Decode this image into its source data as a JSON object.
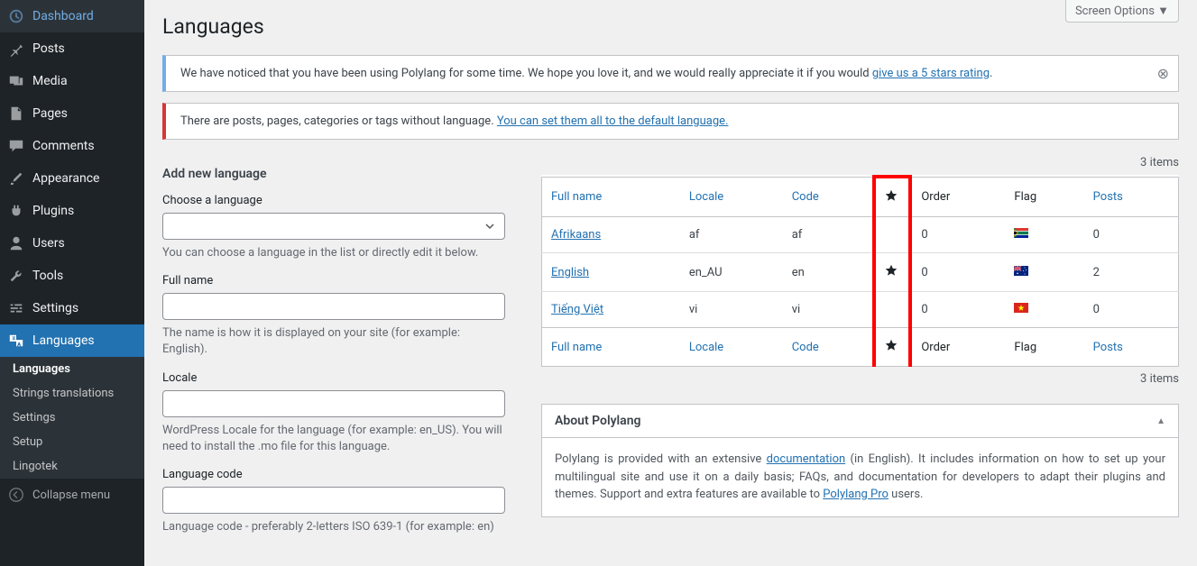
{
  "sidebar": {
    "items": [
      {
        "label": "Dashboard"
      },
      {
        "label": "Posts"
      },
      {
        "label": "Media"
      },
      {
        "label": "Pages"
      },
      {
        "label": "Comments"
      },
      {
        "label": "Appearance"
      },
      {
        "label": "Plugins"
      },
      {
        "label": "Users"
      },
      {
        "label": "Tools"
      },
      {
        "label": "Settings"
      },
      {
        "label": "Languages"
      }
    ],
    "submenu": [
      {
        "label": "Languages"
      },
      {
        "label": "Strings translations"
      },
      {
        "label": "Settings"
      },
      {
        "label": "Setup"
      },
      {
        "label": "Lingotek"
      }
    ],
    "collapse": "Collapse menu"
  },
  "header": {
    "screen_options": "Screen Options  ▼",
    "title": "Languages"
  },
  "notices": {
    "rating_pre": "We have noticed that you have been using Polylang for some time. We hope you love it, and we would really appreciate it if you would ",
    "rating_link": "give us a 5 stars rating",
    "missing_pre": "There are posts, pages, categories or tags without language. ",
    "missing_link": "You can set them all to the default language."
  },
  "form": {
    "section": "Add new language",
    "choose_label": "Choose a language",
    "choose_help": "You can choose a language in the list or directly edit it below.",
    "fullname_label": "Full name",
    "fullname_help": "The name is how it is displayed on your site (for example: English).",
    "locale_label": "Locale",
    "locale_help": "WordPress Locale for the language (for example: en_US). You will need to install the .mo file for this language.",
    "code_label": "Language code",
    "code_help": "Language code - preferably 2-letters ISO 639-1 (for example: en)"
  },
  "table": {
    "items_label": "3 items",
    "headers": {
      "fullname": "Full name",
      "locale": "Locale",
      "code": "Code",
      "order": "Order",
      "flag": "Flag",
      "posts": "Posts"
    },
    "rows": [
      {
        "name": "Afrikaans",
        "locale": "af",
        "code": "af",
        "default": false,
        "order": "0",
        "flag": "za",
        "posts": "0"
      },
      {
        "name": "English",
        "locale": "en_AU",
        "code": "en",
        "default": true,
        "order": "0",
        "flag": "au",
        "posts": "2"
      },
      {
        "name": "Tiếng Việt",
        "locale": "vi",
        "code": "vi",
        "default": false,
        "order": "0",
        "flag": "vn",
        "posts": "0"
      }
    ]
  },
  "about": {
    "title": "About Polylang",
    "body_pre": "Polylang is provided with an extensive ",
    "body_link1": "documentation",
    "body_mid": " (in English). It includes information on how to set up your multilingual site and use it on a daily basis; FAQs, and documentation for developers to adapt their plugins and themes. Support and extra features are available to ",
    "body_link2": "Polylang Pro",
    "body_post": " users."
  }
}
